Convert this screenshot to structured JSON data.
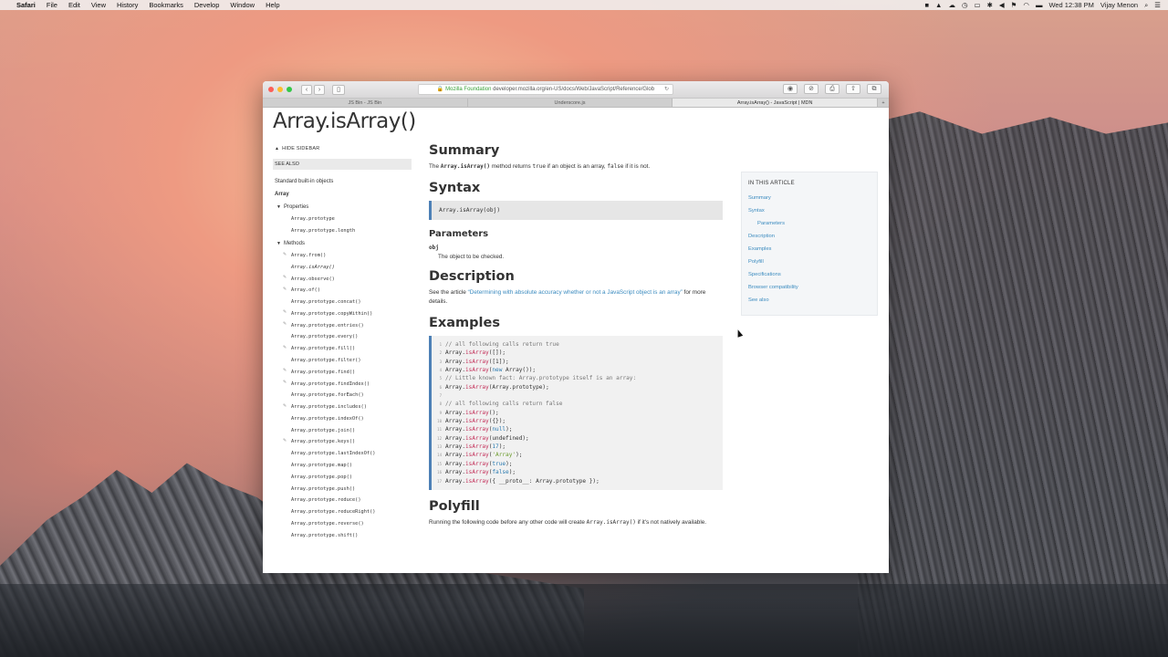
{
  "menubar": {
    "app": "Safari",
    "items": [
      "File",
      "Edit",
      "View",
      "History",
      "Bookmarks",
      "Develop",
      "Window",
      "Help"
    ],
    "clock": "Wed 12:38 PM",
    "user": "Vijay Menon"
  },
  "browser": {
    "address_org": "Mozilla Foundation",
    "address_url": "developer.mozilla.org/en-US/docs/Web/JavaScript/Reference/Glob",
    "tabs": [
      {
        "label": "JS Bin - JS Bin",
        "active": false
      },
      {
        "label": "Underscore.js",
        "active": false
      },
      {
        "label": "Array.isArray() - JavaScript | MDN",
        "active": true
      }
    ]
  },
  "page": {
    "title": "Array.isArray()",
    "sidebar": {
      "hide_label": "HIDE SIDEBAR",
      "see_also": "SEE ALSO",
      "builtins": "Standard built-in objects",
      "array": "Array",
      "properties_label": "Properties",
      "properties": [
        "Array.prototype",
        "Array.prototype.length"
      ],
      "methods_label": "Methods",
      "methods": [
        {
          "name": "Array.from()",
          "obsolete": true,
          "italic": false
        },
        {
          "name": "Array.isArray()",
          "obsolete": false,
          "italic": true
        },
        {
          "name": "Array.observe()",
          "obsolete": true,
          "italic": false
        },
        {
          "name": "Array.of()",
          "obsolete": true,
          "italic": false
        },
        {
          "name": "Array.prototype.concat()",
          "obsolete": false,
          "italic": false
        },
        {
          "name": "Array.prototype.copyWithin()",
          "obsolete": true,
          "italic": false
        },
        {
          "name": "Array.prototype.entries()",
          "obsolete": true,
          "italic": false
        },
        {
          "name": "Array.prototype.every()",
          "obsolete": false,
          "italic": false
        },
        {
          "name": "Array.prototype.fill()",
          "obsolete": true,
          "italic": false
        },
        {
          "name": "Array.prototype.filter()",
          "obsolete": false,
          "italic": false
        },
        {
          "name": "Array.prototype.find()",
          "obsolete": true,
          "italic": false
        },
        {
          "name": "Array.prototype.findIndex()",
          "obsolete": true,
          "italic": false
        },
        {
          "name": "Array.prototype.forEach()",
          "obsolete": false,
          "italic": false
        },
        {
          "name": "Array.prototype.includes()",
          "obsolete": true,
          "italic": false
        },
        {
          "name": "Array.prototype.indexOf()",
          "obsolete": false,
          "italic": false
        },
        {
          "name": "Array.prototype.join()",
          "obsolete": false,
          "italic": false
        },
        {
          "name": "Array.prototype.keys()",
          "obsolete": true,
          "italic": false
        },
        {
          "name": "Array.prototype.lastIndexOf()",
          "obsolete": false,
          "italic": false
        },
        {
          "name": "Array.prototype.map()",
          "obsolete": false,
          "italic": false
        },
        {
          "name": "Array.prototype.pop()",
          "obsolete": false,
          "italic": false
        },
        {
          "name": "Array.prototype.push()",
          "obsolete": false,
          "italic": false
        },
        {
          "name": "Array.prototype.reduce()",
          "obsolete": false,
          "italic": false
        },
        {
          "name": "Array.prototype.reduceRight()",
          "obsolete": false,
          "italic": false
        },
        {
          "name": "Array.prototype.reverse()",
          "obsolete": false,
          "italic": false
        },
        {
          "name": "Array.prototype.shift()",
          "obsolete": false,
          "italic": false
        }
      ]
    },
    "summary": {
      "heading": "Summary",
      "text_pre": "The ",
      "code_method": "Array.isArray()",
      "text_mid1": " method returns ",
      "code_true": "true",
      "text_mid2": " if an object is an array, ",
      "code_false": "false",
      "text_post": " if it is not."
    },
    "syntax": {
      "heading": "Syntax",
      "code": "Array.isArray(obj)",
      "params_heading": "Parameters",
      "param_name": "obj",
      "param_desc": "The object to be checked."
    },
    "description": {
      "heading": "Description",
      "text_pre": "See the article ",
      "link": "“Determining with absolute accuracy whether or not a JavaScript object is an array”",
      "text_post": " for more details."
    },
    "examples": {
      "heading": "Examples",
      "lines": [
        [
          [
            "cm",
            "// all following calls return true"
          ]
        ],
        [
          [
            "",
            "Array."
          ],
          [
            "fn",
            "isArray"
          ],
          [
            "",
            "([]);"
          ]
        ],
        [
          [
            "",
            "Array."
          ],
          [
            "fn",
            "isArray"
          ],
          [
            "",
            "([1]);"
          ]
        ],
        [
          [
            "",
            "Array."
          ],
          [
            "fn",
            "isArray"
          ],
          [
            "",
            "("
          ],
          [
            "kw",
            "new"
          ],
          [
            "",
            " Array());"
          ]
        ],
        [
          [
            "cm",
            "// Little known fact: Array.prototype itself is an array:"
          ]
        ],
        [
          [
            "",
            "Array."
          ],
          [
            "fn",
            "isArray"
          ],
          [
            "",
            "(Array.prototype);"
          ]
        ],
        [],
        [
          [
            "cm",
            "// all following calls return false"
          ]
        ],
        [
          [
            "",
            "Array."
          ],
          [
            "fn",
            "isArray"
          ],
          [
            "",
            "();"
          ]
        ],
        [
          [
            "",
            "Array."
          ],
          [
            "fn",
            "isArray"
          ],
          [
            "",
            "({});"
          ]
        ],
        [
          [
            "",
            "Array."
          ],
          [
            "fn",
            "isArray"
          ],
          [
            "",
            "("
          ],
          [
            "kw",
            "null"
          ],
          [
            "",
            ");"
          ]
        ],
        [
          [
            "",
            "Array."
          ],
          [
            "fn",
            "isArray"
          ],
          [
            "",
            "(undefined);"
          ]
        ],
        [
          [
            "",
            "Array."
          ],
          [
            "fn",
            "isArray"
          ],
          [
            "",
            "("
          ],
          [
            "kw",
            "17"
          ],
          [
            "",
            ");"
          ]
        ],
        [
          [
            "",
            "Array."
          ],
          [
            "fn",
            "isArray"
          ],
          [
            "",
            "("
          ],
          [
            "st",
            "'Array'"
          ],
          [
            "",
            ");"
          ]
        ],
        [
          [
            "",
            "Array."
          ],
          [
            "fn",
            "isArray"
          ],
          [
            "",
            "("
          ],
          [
            "kw",
            "true"
          ],
          [
            "",
            ");"
          ]
        ],
        [
          [
            "",
            "Array."
          ],
          [
            "fn",
            "isArray"
          ],
          [
            "",
            "("
          ],
          [
            "kw",
            "false"
          ],
          [
            "",
            ");"
          ]
        ],
        [
          [
            "",
            "Array."
          ],
          [
            "fn",
            "isArray"
          ],
          [
            "",
            "({ __proto__: Array.prototype });"
          ]
        ]
      ]
    },
    "polyfill": {
      "heading": "Polyfill",
      "text_pre": "Running the following code before any other code will create ",
      "code": "Array.isArray()",
      "text_post": " if it's not natively available."
    },
    "toc": {
      "heading": "IN THIS ARTICLE",
      "items": [
        {
          "label": "Summary",
          "sub": false
        },
        {
          "label": "Syntax",
          "sub": false
        },
        {
          "label": "Parameters",
          "sub": true
        },
        {
          "label": "Description",
          "sub": false
        },
        {
          "label": "Examples",
          "sub": false
        },
        {
          "label": "Polyfill",
          "sub": false
        },
        {
          "label": "Specifications",
          "sub": false
        },
        {
          "label": "Browser compatibility",
          "sub": false
        },
        {
          "label": "See also",
          "sub": false
        }
      ]
    }
  }
}
